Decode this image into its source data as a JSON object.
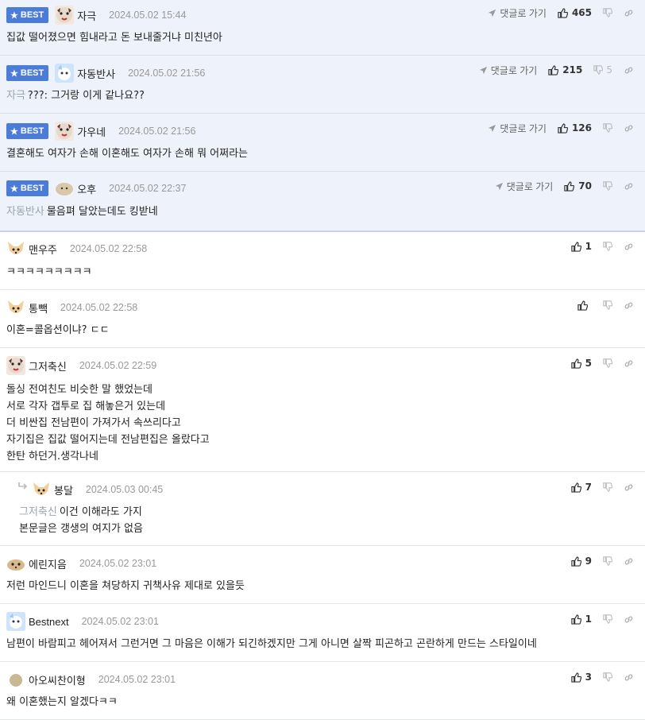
{
  "ui": {
    "best_label": "BEST",
    "reply_link_label": "댓글로 가기"
  },
  "best_comments": [
    {
      "nick": "자극",
      "date": "2024.05.02 15:44",
      "mention": "",
      "text": "집값 떨어졌으면 힘내라고 돈 보내줄거냐 미친년아",
      "likes": "465",
      "dislikes": ""
    },
    {
      "nick": "자동반사",
      "date": "2024.05.02 21:56",
      "mention": "자극",
      "text": "???: 그거랑 이게 같나요??",
      "likes": "215",
      "dislikes": "5"
    },
    {
      "nick": "가우네",
      "date": "2024.05.02 21:56",
      "mention": "",
      "text": "결혼해도 여자가 손해 이혼해도 여자가 손해 뭐 어쩌라는",
      "likes": "126",
      "dislikes": ""
    },
    {
      "nick": "오후",
      "date": "2024.05.02 22:37",
      "mention": "자동반사",
      "text": "물음펴 달았는데도 킹받네",
      "likes": "70",
      "dislikes": ""
    }
  ],
  "comments": [
    {
      "nick": "맨우주",
      "date": "2024.05.02 22:58",
      "mention": "",
      "lines": [
        "ㅋㅋㅋㅋㅋㅋㅋㅋㅋ"
      ],
      "likes": "1"
    },
    {
      "nick": "통빽",
      "date": "2024.05.02 22:58",
      "mention": "",
      "lines": [
        "이혼=콜옵션이냐? ㄷㄷ"
      ],
      "likes": ""
    },
    {
      "nick": "그저축신",
      "date": "2024.05.02 22:59",
      "mention": "",
      "lines": [
        "돌싱 전여친도 비슷한 말 했었는데",
        "서로 각자 갭투로 집 해놓은거 있는데",
        "더 비싼집 전남편이 가져가서 속쓰리다고",
        "자기집은 집값 떨어지는데 전남편집은 올랐다고",
        "한탄 하던거.생각나네"
      ],
      "likes": "5"
    },
    {
      "nick": "봉달",
      "date": "2024.05.03 00:45",
      "mention": "그저축신",
      "lines": [
        "이건 이해라도 가지",
        "본문글은 갱생의 여지가 없음"
      ],
      "likes": "7"
    },
    {
      "nick": "에린지음",
      "date": "2024.05.02 23:01",
      "mention": "",
      "lines": [
        "저런 마인드니 이혼을 쳐당하지 귀책사유 제대로 있을듯"
      ],
      "likes": "9"
    },
    {
      "nick": "Bestnext",
      "date": "2024.05.02 23:01",
      "mention": "",
      "lines": [
        "남편이 바람피고 헤어져서 그런거면 그 마음은 이해가 되긴하겠지만 그게 아니면 살짝 피곤하고 곤란하게 만드는 스타일이네"
      ],
      "likes": "1"
    },
    {
      "nick": "아오씨찬이형",
      "date": "2024.05.02 23:01",
      "mention": "",
      "lines": [
        "왜 이혼했는지 알겠다ㅋㅋ"
      ],
      "likes": "3"
    }
  ],
  "colors": {
    "best_badge": "#4b7dd8",
    "best_background": "#eef2fa",
    "mention": "#9aa3ad"
  },
  "icons": {
    "reply": "paper-plane-icon",
    "like": "thumbs-up-icon",
    "dislike": "thumbs-down-icon",
    "link": "chain-link-icon",
    "reply_indent": "reply-arrow-icon",
    "badge_star": "star-icon"
  }
}
